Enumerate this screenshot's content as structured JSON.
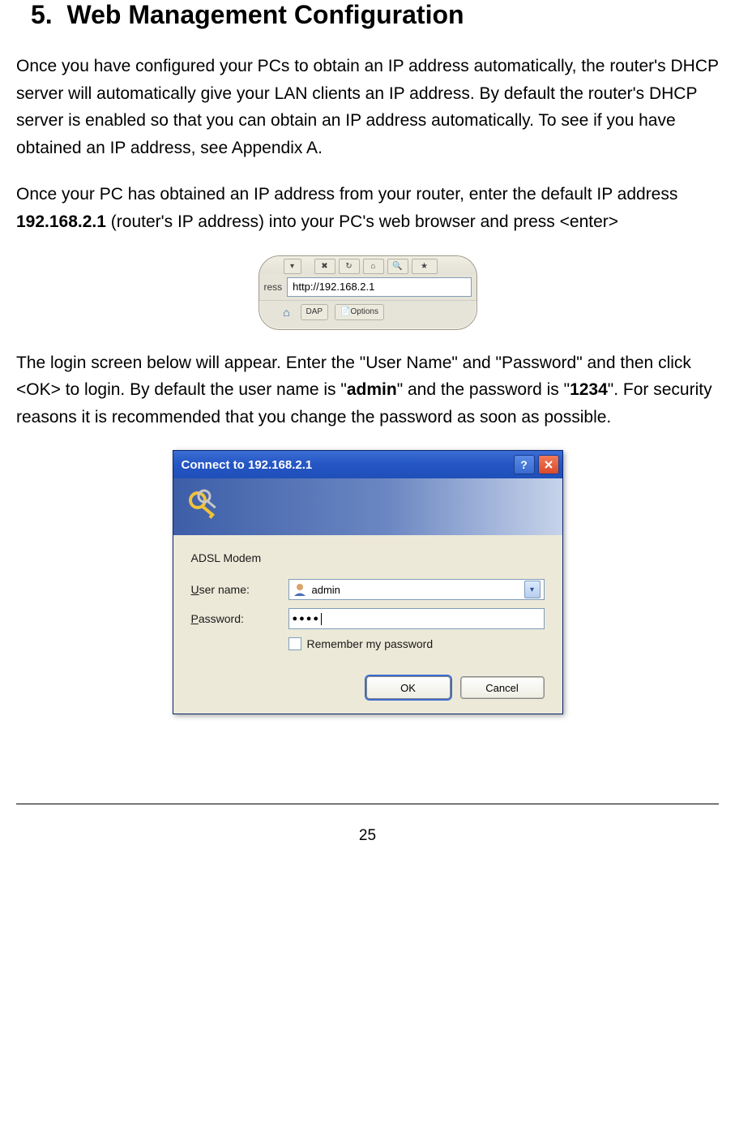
{
  "heading": {
    "number": "5.",
    "title": "Web Management Configuration"
  },
  "para1": "Once you have configured your PCs to obtain an IP address automatically, the router's DHCP server will automatically give your LAN clients an IP address. By default the router's DHCP server is enabled so that you can obtain an IP address automatically. To see if you have obtained an IP address, see Appendix A.",
  "para2_a": "Once your PC has obtained an IP address from your router, enter the default IP address ",
  "para2_bold": "192.168.2.1",
  "para2_b": " (router's IP address) into your PC's web browser and press <enter>",
  "addressbar": {
    "label": "ress",
    "url": "http://192.168.2.1",
    "dap": "DAP",
    "options": "Options"
  },
  "para3_a": "The login screen below will appear. Enter the \"User Name\" and \"Password\" and then click <OK> to login. By default the user name is \"",
  "para3_admin": "admin",
  "para3_b": "\" and the password is \"",
  "para3_1234": "1234",
  "para3_c": "\". For security reasons it is recommended that you change the password as soon as possible.",
  "dialog": {
    "title": "Connect to 192.168.2.1",
    "help": "?",
    "close": "X",
    "device": "ADSL Modem",
    "user_label_u": "U",
    "user_label_rest": "ser name:",
    "pass_label_p": "P",
    "pass_label_rest": "assword:",
    "username": "admin",
    "password_dots": "●●●●",
    "remember_r": "R",
    "remember_rest": "emember my password",
    "ok": "OK",
    "cancel": "Cancel"
  },
  "page_number": "25"
}
